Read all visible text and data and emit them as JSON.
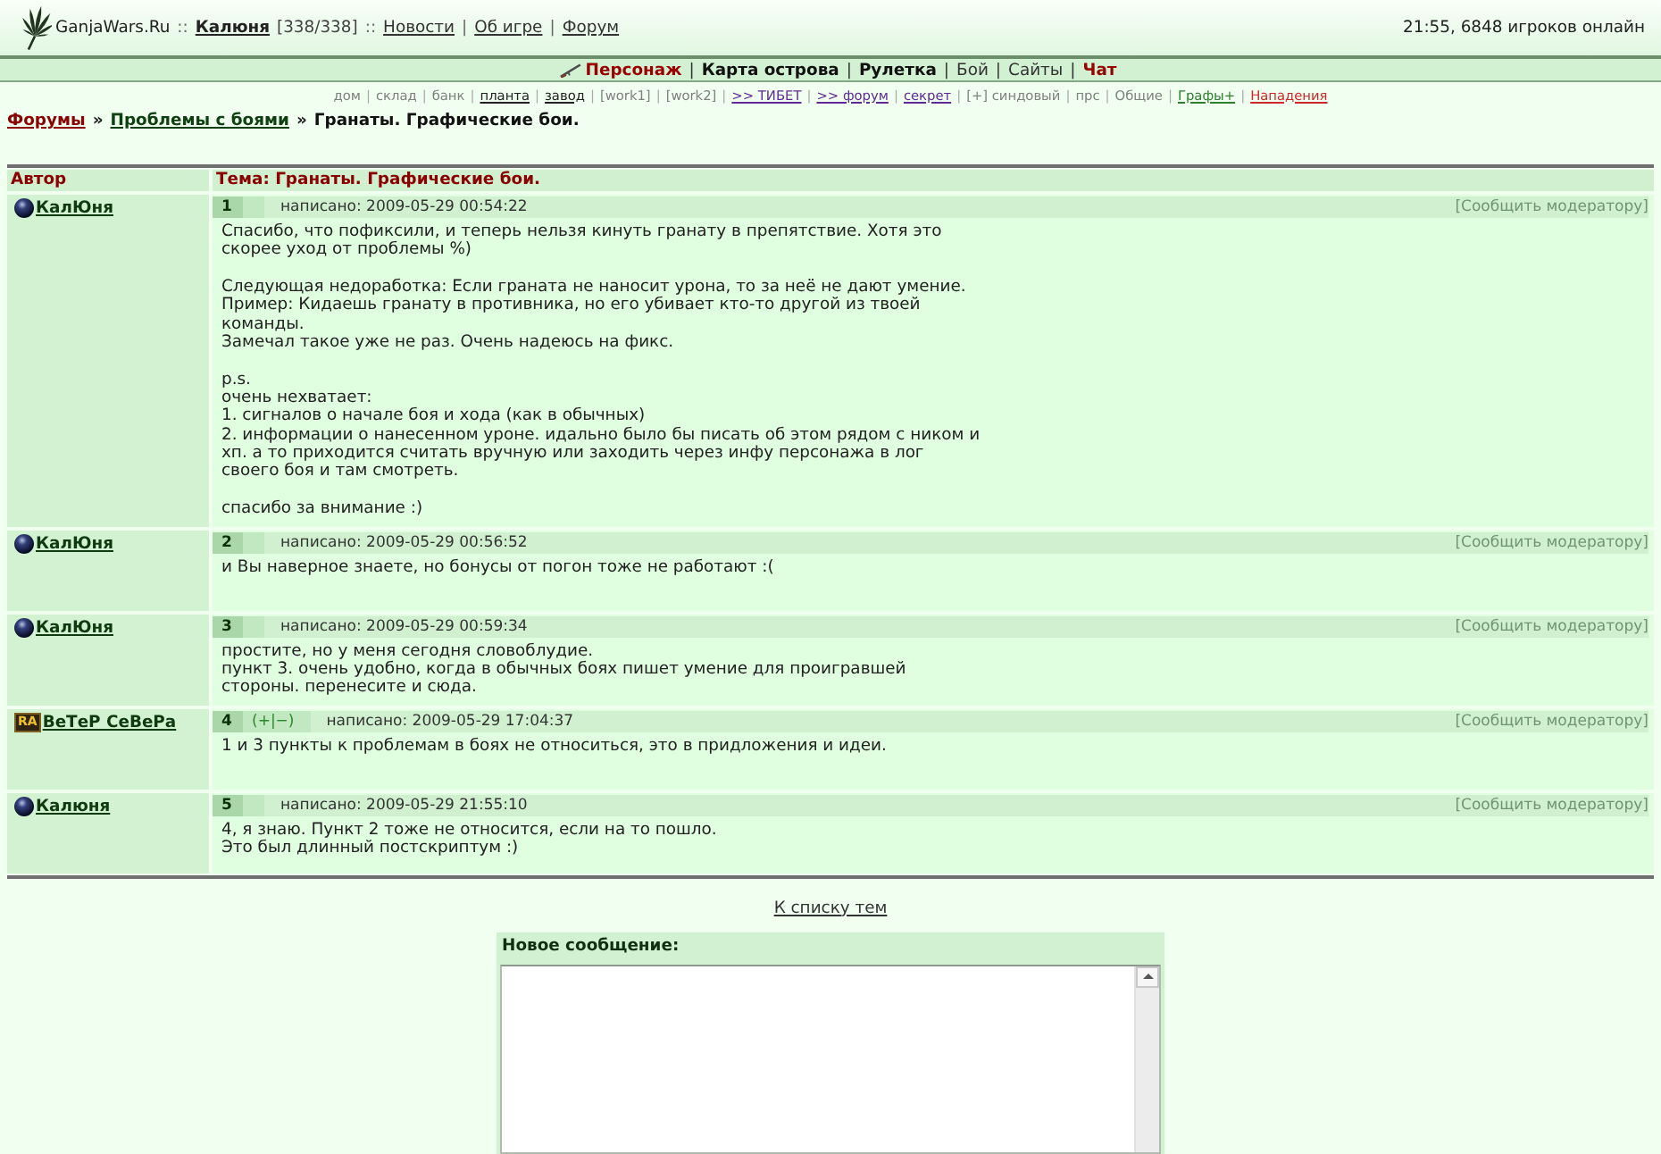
{
  "header": {
    "segments": [
      {
        "kind": "site",
        "text": "GanjaWars.Ru"
      },
      {
        "kind": "sep",
        "text": "::"
      },
      {
        "kind": "user",
        "text": "Калюня"
      },
      {
        "kind": "plain",
        "text": "[338/338]"
      },
      {
        "kind": "sep",
        "text": "::"
      },
      {
        "kind": "link",
        "text": "Новости"
      },
      {
        "kind": "sep",
        "text": "|"
      },
      {
        "kind": "link",
        "text": "Об игре"
      },
      {
        "kind": "sep",
        "text": "|"
      },
      {
        "kind": "link",
        "text": "Форум"
      }
    ],
    "status": "21:55, 6848 игроков онлайн"
  },
  "main_nav": [
    {
      "label": "Персонаж",
      "kind": "accent"
    },
    {
      "sep": "|",
      "label": "Карта острова",
      "kind": "bold"
    },
    {
      "sep": "|",
      "label": "Рулетка",
      "kind": "bold"
    },
    {
      "sep": "|",
      "label": "Бой",
      "kind": "plain"
    },
    {
      "sep": "|",
      "label": "Сайты",
      "kind": "plain"
    },
    {
      "sep": "|",
      "label": "Чат",
      "kind": "accent"
    }
  ],
  "sub_nav": [
    {
      "label": "дом",
      "kind": "plain"
    },
    {
      "sep": "|",
      "label": "склад",
      "kind": "plain"
    },
    {
      "sep": "|",
      "label": "банк",
      "kind": "plain"
    },
    {
      "sep": "|",
      "label": "планта",
      "kind": "link"
    },
    {
      "sep": "|",
      "label": "завод",
      "kind": "link"
    },
    {
      "sep": "|",
      "label": "[work1]",
      "kind": "plain"
    },
    {
      "sep": "|",
      "label": "[work2]",
      "kind": "plain"
    },
    {
      "sep": "|",
      "label": ">> ТИБЕТ",
      "kind": "visited"
    },
    {
      "sep": "|",
      "label": ">> форум",
      "kind": "visited"
    },
    {
      "sep": "|",
      "label": "секрет",
      "kind": "visited"
    },
    {
      "sep": "|",
      "label": "[+] синдовый",
      "kind": "plain"
    },
    {
      "sep": "|",
      "label": "прс",
      "kind": "plain"
    },
    {
      "sep": "|",
      "label": "Общие",
      "kind": "plain"
    },
    {
      "sep": "|",
      "label": "Графы+",
      "kind": "group"
    },
    {
      "sep": "|",
      "label": "Нападения",
      "kind": "alert"
    }
  ],
  "breadcrumb": [
    {
      "label": "Форумы",
      "kind": "root"
    },
    {
      "sep": "»",
      "label": "Проблемы с боями",
      "kind": "section"
    },
    {
      "sep": "»",
      "label": "Гранаты. Графические бои.",
      "kind": "current"
    }
  ],
  "table": {
    "columns": [
      "Автор",
      "Тема: Гранаты. Графические бои."
    ]
  },
  "posts": [
    {
      "author": {
        "name": "КалЮня",
        "badge": {
          "kind": "sphere"
        }
      },
      "number": "1",
      "date": "написано: 2009-05-29 00:54:22",
      "report": "[Сообщить модератору]",
      "text": "Спасибо, что пофиксили, и теперь нельзя кинуть гранату в препятствие. Хотя это скорее уход от проблемы %)\n\nСледующая недоработка: Если граната не наносит урона, то за неё не дают умение.\nПример: Кидаешь гранату в противника, но его убивает кто-то другой из твоей команды.\nЗамечал такое уже не раз. Очень надеюсь на фикс.\n\np.s.\nочень нехватает:\n1. сигналов о начале боя и хода (как в обычных)\n2. информации о нанесенном уроне. идально было бы писать об этом рядом с ником и хп. а то приходится считать вручную или заходить через инфу персонажа в лог своего боя и там смотреть.\n\nспасибо за внимание :)"
    },
    {
      "author": {
        "name": "КалЮня",
        "badge": {
          "kind": "sphere"
        }
      },
      "number": "2",
      "date": "написано: 2009-05-29 00:56:52",
      "report": "[Сообщить модератору]",
      "text": "и Вы наверное знаете, но бонусы от погон тоже не работают :("
    },
    {
      "author": {
        "name": "КалЮня",
        "badge": {
          "kind": "sphere"
        }
      },
      "number": "3",
      "date": "написано: 2009-05-29 00:59:34",
      "report": "[Сообщить модератору]",
      "text": "простите, но у меня сегодня словоблудие.\nпункт 3. очень удобно, когда в обычных боях пишет умение для проигравшей стороны. перенесите и сюда."
    },
    {
      "author": {
        "name": "ВеТеР СеВеРа",
        "badge": {
          "kind": "clan",
          "label": "RA"
        }
      },
      "number": "4",
      "rating": "(+|−)",
      "date": "написано: 2009-05-29 17:04:37",
      "report": "[Сообщить модератору]",
      "text": "1 и 3 пункты к проблемам в боях не относиться, это в придложения и идеи."
    },
    {
      "author": {
        "name": "Калюня",
        "badge": {
          "kind": "sphere"
        }
      },
      "number": "5",
      "date": "написано: 2009-05-29 21:55:10",
      "report": "[Сообщить модератору]",
      "text": "4, я знаю. Пункт 2 тоже не относится, если на то пошло.\nЭто был длинный постскриптум :)"
    }
  ],
  "back_link": "К списку тем",
  "new_message": {
    "title": "Новое сообщение:"
  }
}
